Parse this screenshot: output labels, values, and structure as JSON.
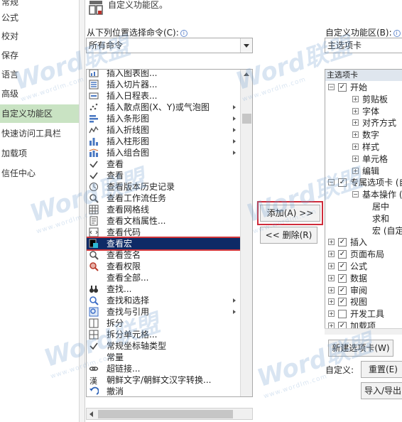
{
  "nav": {
    "items": [
      {
        "label": "常规",
        "active": false
      },
      {
        "label": "公式",
        "active": false
      },
      {
        "label": "校对",
        "active": false
      },
      {
        "label": "保存",
        "active": false
      },
      {
        "label": "语言",
        "active": false
      },
      {
        "label": "高级",
        "active": false
      },
      {
        "label": "自定义功能区",
        "active": true
      },
      {
        "label": "快速访问工具栏",
        "active": false
      },
      {
        "label": "加载项",
        "active": false
      },
      {
        "label": "信任中心",
        "active": false
      }
    ]
  },
  "header": {
    "title": "自定义功能区。"
  },
  "left_panel": {
    "label": "从下列位置选择命令(C):",
    "combo_value": "所有命令"
  },
  "right_panel": {
    "label": "自定义功能区(B):",
    "combo_value": "主选项卡"
  },
  "commands": [
    {
      "label": "插入图表图...",
      "icon": "chart-icon",
      "submenu": false
    },
    {
      "label": "插入切片器...",
      "icon": "slicer-icon",
      "submenu": false
    },
    {
      "label": "插入日程表...",
      "icon": "timeline-icon",
      "submenu": false
    },
    {
      "label": "插入散点图(X、Y)或气泡图",
      "icon": "scatter-chart-icon",
      "submenu": true
    },
    {
      "label": "插入条形图",
      "icon": "bar-chart-icon",
      "submenu": true
    },
    {
      "label": "插入折线图",
      "icon": "line-chart-icon",
      "submenu": true
    },
    {
      "label": "插入柱形图",
      "icon": "column-chart-icon",
      "submenu": true
    },
    {
      "label": "插入组合图",
      "icon": "combo-chart-icon",
      "submenu": true
    },
    {
      "label": "查看",
      "icon": "check-icon",
      "submenu": false
    },
    {
      "label": "查看",
      "icon": "check-icon",
      "submenu": false
    },
    {
      "label": "查看版本历史记录",
      "icon": "history-icon",
      "submenu": false
    },
    {
      "label": "查看工作流任务",
      "icon": "workflow-icon",
      "submenu": false
    },
    {
      "label": "查看网格线",
      "icon": "gridlines-icon",
      "submenu": false
    },
    {
      "label": "查看文档属性...",
      "icon": "properties-icon",
      "submenu": false
    },
    {
      "label": "查看代码",
      "icon": "code-icon",
      "submenu": false
    },
    {
      "label": "查看宏",
      "icon": "macro-icon",
      "submenu": false,
      "selected": true
    },
    {
      "label": "查看签名",
      "icon": "signature-icon",
      "submenu": false
    },
    {
      "label": "查看权限",
      "icon": "permission-icon",
      "submenu": false
    },
    {
      "label": "查看全部...",
      "icon": "blank-icon",
      "submenu": false
    },
    {
      "label": "查找...",
      "icon": "binoculars-icon",
      "submenu": false
    },
    {
      "label": "查找和选择",
      "icon": "find-select-icon",
      "submenu": true
    },
    {
      "label": "查找与引用",
      "icon": "find-reference-icon",
      "submenu": true
    },
    {
      "label": "拆分",
      "icon": "split-icon",
      "submenu": false
    },
    {
      "label": "拆分单元格...",
      "icon": "split-cells-icon",
      "submenu": false
    },
    {
      "label": "常规坐标轴类型",
      "icon": "check-icon",
      "submenu": false
    },
    {
      "label": "常量",
      "icon": "blank-icon",
      "submenu": false
    },
    {
      "label": "超链接...",
      "icon": "hyperlink-icon",
      "submenu": false
    },
    {
      "label": "朝鲜文字/朝鲜文汉字转换...",
      "icon": "hanja-icon",
      "submenu": false
    },
    {
      "label": "撤消",
      "icon": "undo-icon",
      "submenu": false
    }
  ],
  "buttons": {
    "add": "添加(A) >>",
    "remove": "<< 删除(R)",
    "new_tab": "新建选项卡(W)",
    "reset": "重置(E)",
    "import_export": "导入/导出"
  },
  "customize_label": "自定义:",
  "tree": {
    "header": "主选项卡",
    "rows": [
      {
        "label": "开始",
        "level": 0,
        "exp": "minus",
        "checked": true
      },
      {
        "label": "剪贴板",
        "level": 1,
        "exp": "plus"
      },
      {
        "label": "字体",
        "level": 1,
        "exp": "plus"
      },
      {
        "label": "对齐方式",
        "level": 1,
        "exp": "plus"
      },
      {
        "label": "数字",
        "level": 1,
        "exp": "plus"
      },
      {
        "label": "样式",
        "level": 1,
        "exp": "plus"
      },
      {
        "label": "单元格",
        "level": 1,
        "exp": "plus"
      },
      {
        "label": "编辑",
        "level": 1,
        "exp": "plus"
      },
      {
        "label": "专属选项卡 (自",
        "level": 0,
        "exp": "minus",
        "checked": true
      },
      {
        "label": "基本操作 (自",
        "level": 1,
        "exp": "minus"
      },
      {
        "label": "居中",
        "level": 2,
        "exp": "none"
      },
      {
        "label": "求和",
        "level": 2,
        "exp": "none"
      },
      {
        "label": "宏 (自定义",
        "level": 2,
        "exp": "none"
      },
      {
        "label": "插入",
        "level": 0,
        "exp": "plus",
        "checked": true
      },
      {
        "label": "页面布局",
        "level": 0,
        "exp": "plus",
        "checked": true
      },
      {
        "label": "公式",
        "level": 0,
        "exp": "plus",
        "checked": true
      },
      {
        "label": "数据",
        "level": 0,
        "exp": "plus",
        "checked": true
      },
      {
        "label": "审阅",
        "level": 0,
        "exp": "plus",
        "checked": true
      },
      {
        "label": "视图",
        "level": 0,
        "exp": "plus",
        "checked": true
      },
      {
        "label": "开发工具",
        "level": 0,
        "exp": "plus",
        "checked": false
      },
      {
        "label": "加载项",
        "level": 0,
        "exp": "plus",
        "checked": true
      }
    ]
  },
  "watermark": {
    "brand": "Word联盟",
    "url": "www.wordlm.com"
  },
  "colors": {
    "selection": "#0e2a66",
    "highlight": "#d2353a",
    "nav_active": "#c9e3c3"
  }
}
